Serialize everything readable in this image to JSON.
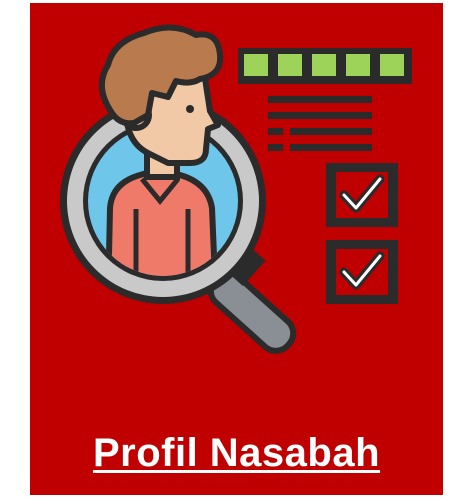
{
  "tile": {
    "title": "Profil Nasabah",
    "icon": "customer-profile-search-icon",
    "colors": {
      "background": "#c00000",
      "title": "#ffffff",
      "outline": "#2b2b2b",
      "green_bar": "#9ed35a",
      "hair": "#b97a4d",
      "skin": "#f2c9a6",
      "shirt": "#f07a6a",
      "lens": "#6ec6ea",
      "handle": "#8a8f96",
      "check": "#ffffff"
    }
  }
}
